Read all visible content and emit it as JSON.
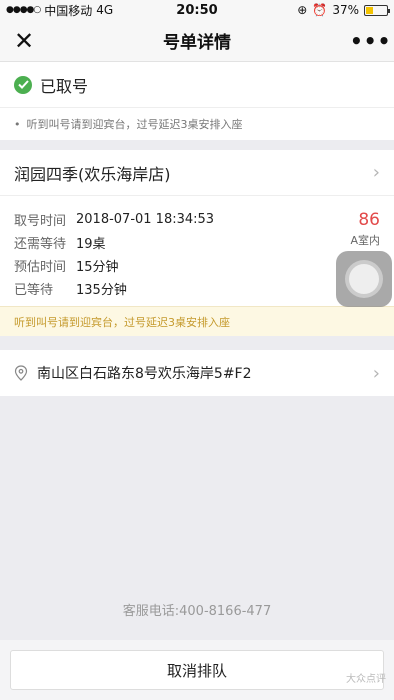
{
  "status_bar": {
    "carrier": "中国移动",
    "network": "4G",
    "time": "20:50",
    "battery": "37%",
    "battery_level": 0.37
  },
  "nav": {
    "title": "号单详情",
    "close_glyph": "✕",
    "more_glyph": "•••"
  },
  "status": {
    "label": "已取号",
    "tip": "听到叫号请到迎宾台，过号延迟3桌安排入座"
  },
  "store": {
    "name": "润园四季(欢乐海岸店)",
    "details": [
      {
        "label": "取号时间",
        "value": "2018-07-01 18:34:53"
      },
      {
        "label": "还需等待",
        "value": "19桌"
      },
      {
        "label": "预估时间",
        "value": "15分钟"
      },
      {
        "label": "已等待",
        "value": "135分钟"
      }
    ],
    "queue_number": "86",
    "queue_room": "A室内",
    "notice": "听到叫号请到迎宾台，过号延迟3桌安排入座"
  },
  "address": {
    "text": "南山区白石路东8号欢乐海岸5#F2"
  },
  "service_phone": "客服电话:400-8166-477",
  "cancel_label": "取消排队",
  "watermark": "大众点评",
  "colors": {
    "accent_green": "#4caf50",
    "queue_red": "#e24a4a",
    "notice_bg": "#fdf8e3",
    "notice_text": "#c59a2d"
  }
}
